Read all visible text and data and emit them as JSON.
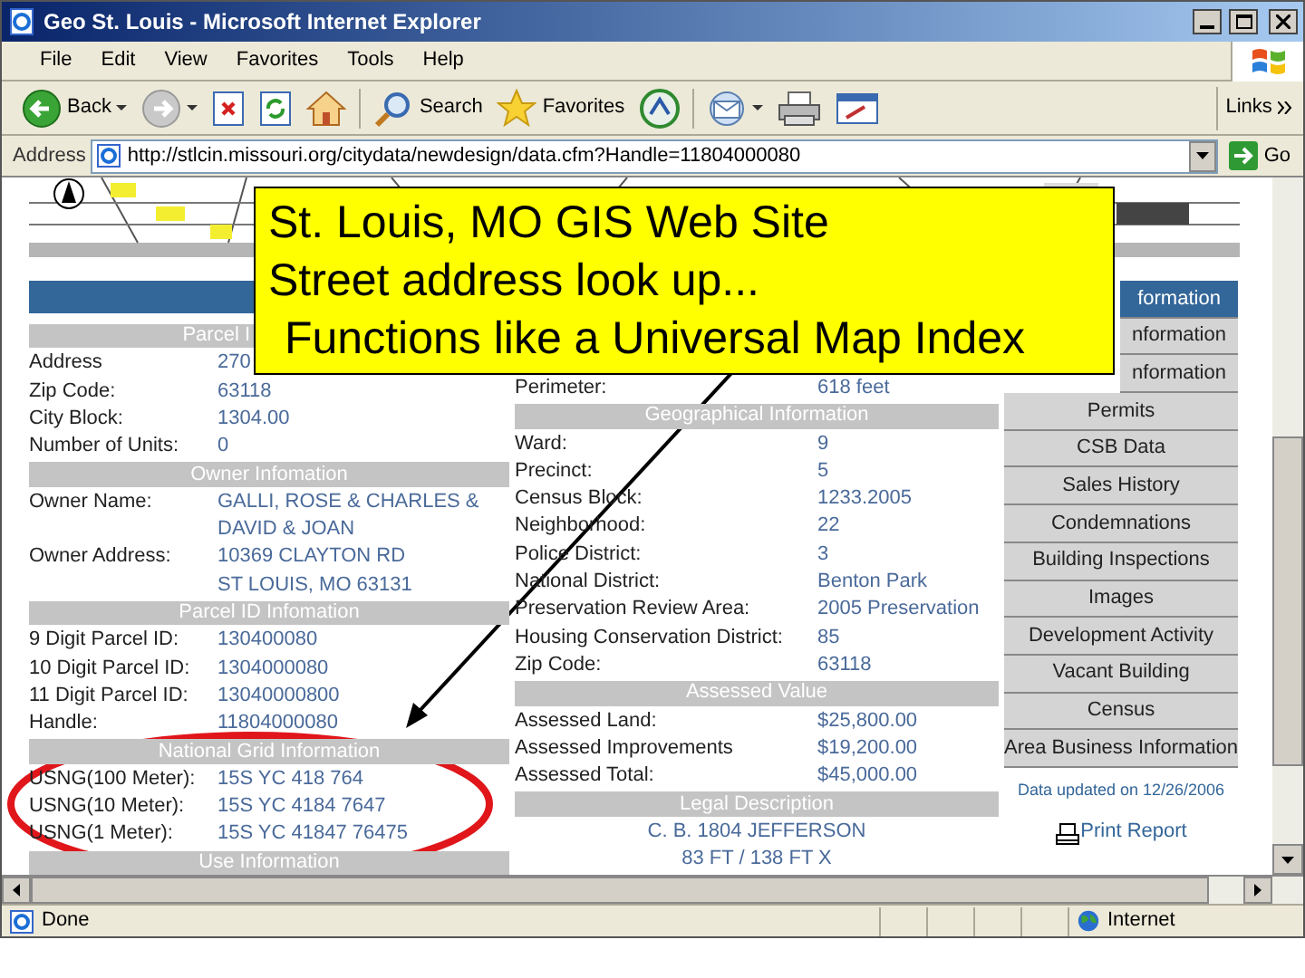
{
  "window": {
    "title": "Geo St. Louis - Microsoft Internet Explorer"
  },
  "menu": [
    "File",
    "Edit",
    "View",
    "Favorites",
    "Tools",
    "Help"
  ],
  "toolbar": [
    {
      "kind": "back",
      "label": "Back"
    },
    {
      "kind": "forward"
    },
    {
      "kind": "stop"
    },
    {
      "kind": "refresh"
    },
    {
      "kind": "home"
    },
    {
      "kind": "search",
      "label": "Search"
    },
    {
      "kind": "favorites",
      "label": "Favorites"
    },
    {
      "kind": "media"
    },
    {
      "kind": "mail"
    },
    {
      "kind": "print"
    },
    {
      "kind": "edit"
    }
  ],
  "links": "Links",
  "address": {
    "label": "Address",
    "value": "http://stlcin.missouri.org/citydata/newdesign/data.cfm?Handle=11804000080",
    "go": "Go"
  },
  "left": [
    {
      "kind": "header",
      "text": "Parcel I",
      "cut": true
    },
    {
      "kind": "field",
      "label": "Address",
      "values": [
        "270"
      ]
    },
    {
      "kind": "field",
      "label": "Zip Code:",
      "values": [
        "63118"
      ]
    },
    {
      "kind": "field",
      "label": "City Block:",
      "values": [
        "1304.00"
      ]
    },
    {
      "kind": "field",
      "label": "Number of Units:",
      "values": [
        "0"
      ]
    },
    {
      "kind": "header",
      "text": "Owner Infomation",
      "cut": false
    },
    {
      "kind": "field",
      "label": "Owner Name:",
      "values": [
        "GALLI, ROSE & CHARLES &",
        "DAVID & JOAN"
      ]
    },
    {
      "kind": "field",
      "label": "Owner Address:",
      "values": [
        "10369 CLAYTON RD",
        "ST LOUIS, MO 63131"
      ]
    },
    {
      "kind": "header",
      "text": "Parcel ID Infomation",
      "cut": false
    },
    {
      "kind": "field",
      "label": "9 Digit Parcel ID:",
      "values": [
        "130400080"
      ]
    },
    {
      "kind": "field",
      "label": "10 Digit Parcel ID:",
      "values": [
        "1304000080"
      ]
    },
    {
      "kind": "field",
      "label": "11 Digit Parcel ID:",
      "values": [
        "13040000800"
      ]
    },
    {
      "kind": "field",
      "label": "Handle:",
      "values": [
        "11804000080"
      ]
    },
    {
      "kind": "header",
      "text": "National Grid Information",
      "cut": false
    },
    {
      "kind": "field",
      "label": "USNG(100 Meter):",
      "values": [
        "15S YC 418 764"
      ]
    },
    {
      "kind": "field",
      "label": "USNG(10 Meter):",
      "values": [
        "15S YC 4184 7647"
      ]
    },
    {
      "kind": "field",
      "label": "USNG(1 Meter):",
      "values": [
        "15S YC 41847 76475"
      ]
    },
    {
      "kind": "header",
      "text": "Use Information",
      "cut": false
    }
  ],
  "middle": [
    {
      "kind": "field",
      "label": "Perimeter:",
      "values": [
        "618 feet"
      ]
    },
    {
      "kind": "header",
      "text": "Geographical Information",
      "cut": false
    },
    {
      "kind": "field",
      "label": "Ward:",
      "values": [
        "9"
      ]
    },
    {
      "kind": "field",
      "label": "Precinct:",
      "values": [
        "5"
      ]
    },
    {
      "kind": "field",
      "label": "Census Block:",
      "values": [
        "1233.2005"
      ]
    },
    {
      "kind": "field",
      "label": "Neighborhood:",
      "values": [
        "22"
      ]
    },
    {
      "kind": "field",
      "label": "Police District:",
      "values": [
        "3"
      ]
    },
    {
      "kind": "field",
      "label": "National District:",
      "values": [
        "Benton Park"
      ]
    },
    {
      "kind": "field",
      "label": "Preservation Review Area:",
      "values": [
        "2005 Preservation"
      ]
    },
    {
      "kind": "field",
      "label": "Housing Conservation District:",
      "values": [
        "85"
      ]
    },
    {
      "kind": "field",
      "label": "Zip Code:",
      "values": [
        "63118"
      ]
    },
    {
      "kind": "header",
      "text": "Assessed Value",
      "cut": false
    },
    {
      "kind": "field",
      "label": "Assessed Land:",
      "values": [
        "$25,800.00"
      ]
    },
    {
      "kind": "field",
      "label": "Assessed Improvements",
      "values": [
        "$19,200.00"
      ]
    },
    {
      "kind": "field",
      "label": "Assessed Total:",
      "values": [
        "$45,000.00"
      ]
    },
    {
      "kind": "header",
      "text": "Legal Description",
      "cut": false
    },
    {
      "kind": "center",
      "text": "C. B. 1804 JEFFERSON"
    },
    {
      "kind": "center",
      "text": "83 FT / 138 FT X"
    }
  ],
  "nav": [
    {
      "label": "formation",
      "selected": true,
      "cut": true
    },
    {
      "label": "nformation",
      "selected": false,
      "cut": true
    },
    {
      "label": "nformation",
      "selected": false,
      "cut": true
    },
    {
      "label": "Permits",
      "selected": false,
      "cut": false
    },
    {
      "label": "CSB Data",
      "selected": false,
      "cut": false
    },
    {
      "label": "Sales History",
      "selected": false,
      "cut": false
    },
    {
      "label": "Condemnations",
      "selected": false,
      "cut": false
    },
    {
      "label": "Building Inspections",
      "selected": false,
      "cut": false
    },
    {
      "label": "Images",
      "selected": false,
      "cut": false
    },
    {
      "label": "Development Activity",
      "selected": false,
      "cut": false
    },
    {
      "label": "Vacant Building",
      "selected": false,
      "cut": false
    },
    {
      "label": "Census",
      "selected": false,
      "cut": false
    },
    {
      "label": "Area Business Information",
      "selected": false,
      "cut": false
    }
  ],
  "updated": "Data updated on 12/26/2006",
  "print": "Print Report",
  "callout": [
    "St. Louis, MO GIS Web Site",
    "Street address look up...",
    "Functions like a Universal Map Index"
  ],
  "status_bar": {
    "text": "Done",
    "zone": "Internet"
  }
}
